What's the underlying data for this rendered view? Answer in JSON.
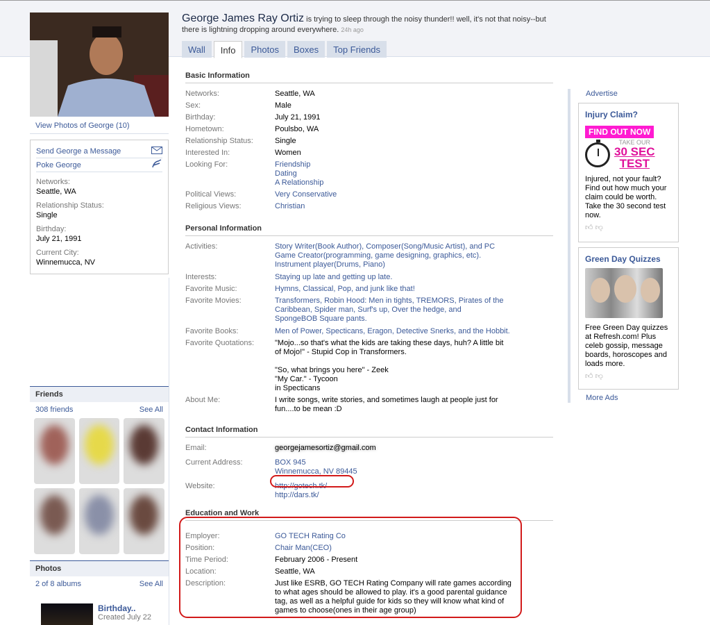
{
  "profile": {
    "name": "George James Ray Ortiz",
    "status": "is trying to sleep through the noisy thunder!! well, it's not that noisy--but there is lightning dropping around everywhere.",
    "time": "24h ago",
    "view_photos": "View Photos of George (10)"
  },
  "tabs": [
    "Wall",
    "Info",
    "Photos",
    "Boxes",
    "Top Friends"
  ],
  "left": {
    "send_message": "Send George a Message",
    "poke": "Poke George",
    "networks_label": "Networks:",
    "networks": "Seattle, WA",
    "rel_label": "Relationship Status:",
    "rel": "Single",
    "bday_label": "Birthday:",
    "bday": "July 21, 1991",
    "city_label": "Current City:",
    "city": "Winnemucca, NV"
  },
  "friends": {
    "title": "Friends",
    "count": "308 friends",
    "see_all": "See All"
  },
  "photos": {
    "title": "Photos",
    "count": "2 of 8 albums",
    "see_all": "See All",
    "album_title": "Birthday..",
    "album_date": "Created July 22"
  },
  "basic": {
    "title": "Basic Information",
    "networks_k": "Networks:",
    "networks_v": "Seattle, WA",
    "sex_k": "Sex:",
    "sex_v": "Male",
    "bday_k": "Birthday:",
    "bday_v": "July 21, 1991",
    "home_k": "Hometown:",
    "home_v": "Poulsbo, WA",
    "rel_k": "Relationship Status:",
    "rel_v": "Single",
    "int_k": "Interested In:",
    "int_v": "Women",
    "look_k": "Looking For:",
    "look_1": "Friendship",
    "look_2": "Dating",
    "look_3": "A Relationship",
    "pol_k": "Political Views:",
    "pol_v": "Very Conservative",
    "rel2_k": "Religious Views:",
    "rel2_v": "Christian"
  },
  "personal": {
    "title": "Personal Information",
    "act_k": "Activities:",
    "act_v": "Story Writer(Book Author), Composer(Song/Music Artist), and PC Game Creator(programming, game designing, graphics, etc). Instrument player(Drums, Piano)",
    "int_k": "Interests:",
    "int_v": "Staying up late and getting up late.",
    "music_k": "Favorite Music:",
    "music_v": "Hymns, Classical, Pop, and junk like that!",
    "movies_k": "Favorite Movies:",
    "movies_v": "Transformers, Robin Hood: Men in tights, TREMORS, Pirates of the Caribbean, Spider man, Surf's up, Over the hedge, and SpongeBOB Square pants.",
    "books_k": "Favorite Books:",
    "books_v": "Men of Power, Specticans, Eragon, Detective Snerks, and the Hobbit.",
    "quotes_k": "Favorite Quotations:",
    "quote_1": "\"Mojo...so that's what the kids are taking these days, huh? A little bit of Mojo!\" - Stupid Cop in Transformers.",
    "quote_2": "\"So, what brings you here\" - Zeek",
    "quote_3": "\"My Car.\" - Tycoon",
    "quote_4": "in Specticans",
    "about_k": "About Me:",
    "about_v": "I write songs, write stories, and sometimes laugh at people just for fun....to be mean :D"
  },
  "contact": {
    "title": "Contact Information",
    "email_k": "Email:",
    "email_v": "georgejamesortiz@gmail.com",
    "addr_k": "Current Address:",
    "addr_1": "BOX 945",
    "addr_2": "Winnemucca, NV 89445",
    "web_k": "Website:",
    "web_1": "http://gotech.tk/",
    "web_2": "http://dars.tk/"
  },
  "education": {
    "title": "Education and Work",
    "emp_k": "Employer:",
    "emp_v": "GO TECH Rating Co",
    "pos_k": "Position:",
    "pos_v": "Chair Man(CEO)",
    "time_k": "Time Period:",
    "time_v": "February 2006 - Present",
    "loc_k": "Location:",
    "loc_v": "Seattle, WA",
    "desc_k": "Description:",
    "desc_v": "Just like ESRB, GO TECH Rating Company will rate games according to what ages should be allowed to play. it's a good parental guidance tag, as well as a helpful guide for kids so they will know what kind of games to choose(ones in their age group)"
  },
  "ads": {
    "advertise": "Advertise",
    "ad1_title": "Injury Claim?",
    "ad1_cta": "FIND OUT NOW",
    "ad1_take": "TAKE OUR",
    "ad1_sec": "30 SEC",
    "ad1_test": "TEST",
    "ad1_text": "Injured, not your fault? Find out how much your claim could be worth. Take the 30 second test now.",
    "ad2_title": "Green Day Quizzes",
    "ad2_text": "Free Green Day quizzes at Refresh.com! Plus celeb gossip, message boards, horoscopes and loads more.",
    "more_ads": "More Ads"
  },
  "colors": {
    "link": "#3b5998",
    "annotation_red": "#d21a1a",
    "ad_pink": "#ff1ad1"
  }
}
